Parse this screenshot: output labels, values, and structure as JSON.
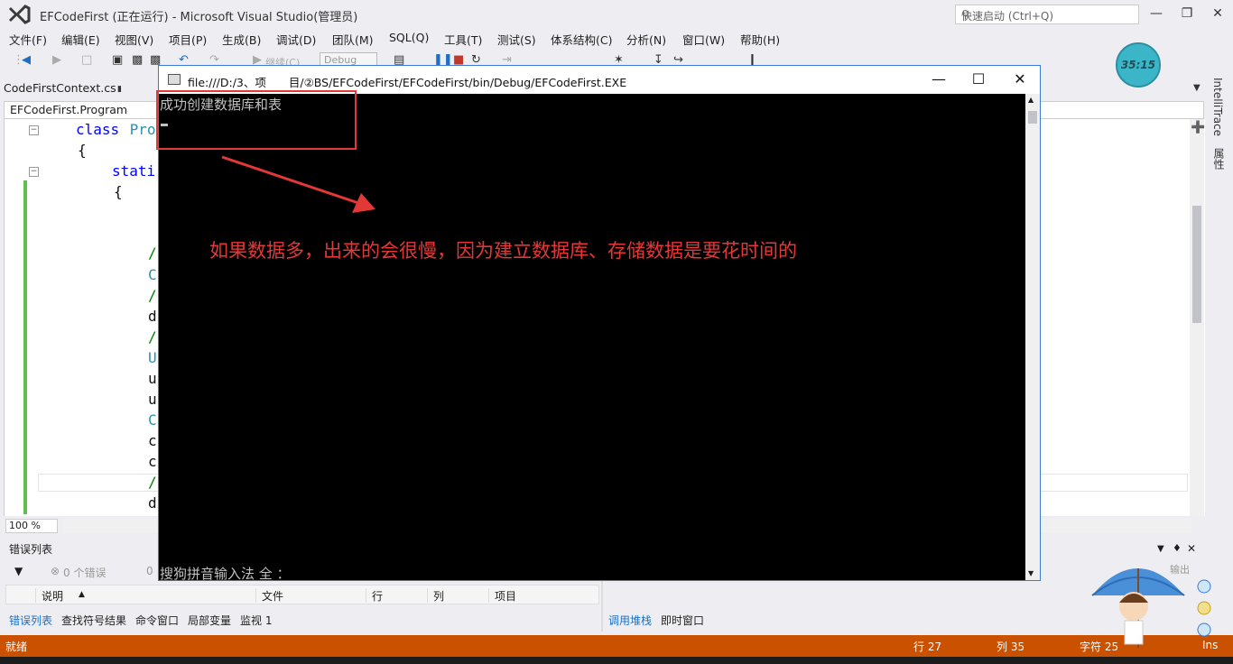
{
  "window": {
    "title": "EFCodeFirst (正在运行) - Microsoft Visual Studio(管理员)",
    "quick_launch_placeholder": "快速启动 (Ctrl+Q)"
  },
  "menu": [
    "文件(F)",
    "编辑(E)",
    "视图(V)",
    "项目(P)",
    "生成(B)",
    "调试(D)",
    "团队(M)",
    "SQL(Q)",
    "工具(T)",
    "测试(S)",
    "体系结构(C)",
    "分析(N)",
    "窗口(W)",
    "帮助(H)"
  ],
  "toolbar": {
    "continue_label": "继续(C)",
    "config_value": "Debug"
  },
  "clock": "35:15",
  "editor": {
    "doc_tab": "CodeFirstContext.cs",
    "nav_class": "EFCodeFirst.Program",
    "zoom": "100 %",
    "lines": {
      "l1_kw": "class",
      "l1_name": " Pro",
      "l2": "{",
      "l3": "stati",
      "l4": "{",
      "c1": "/",
      "c2": "C",
      "c3": "/",
      "c4": "d",
      "c5": "/",
      "c6": "U",
      "c7": "u",
      "c8": "u",
      "c9": "C",
      "c10": "c",
      "c11": "c",
      "c12": "/",
      "c13": "d"
    }
  },
  "right_rail": {
    "intellitrace": "IntelliTrace",
    "properties": "属性"
  },
  "error_list": {
    "title": "错误列表",
    "errors": "0 个错误",
    "warnings_prefix": "0",
    "columns": [
      "说明",
      "文件",
      "行",
      "列",
      "项目"
    ]
  },
  "bottom_tabs_left": [
    "错误列表",
    "查找符号结果",
    "命令窗口",
    "局部变量",
    "监视 1"
  ],
  "bottom_tabs_right": [
    "调用堆栈",
    "即时窗口"
  ],
  "right_panel_partial": "输出",
  "status": {
    "ready": "就绪",
    "line": "行 27",
    "col": "列 35",
    "char": "字符 25",
    "mode": "Ins"
  },
  "console": {
    "title": "file:///D:/3、项　　目/②BS/EFCodeFirst/EFCodeFirst/bin/Debug/EFCodeFirst.EXE",
    "output": "成功创建数据库和表",
    "ime": "搜狗拼音输入法 全 ："
  },
  "annotation": "如果数据多，出来的会很慢，因为建立数据库、存储数据是要花时间的",
  "colors": {
    "status_bar": "#ca5100",
    "annotation_red": "#e23838",
    "console_bg": "#000000"
  }
}
